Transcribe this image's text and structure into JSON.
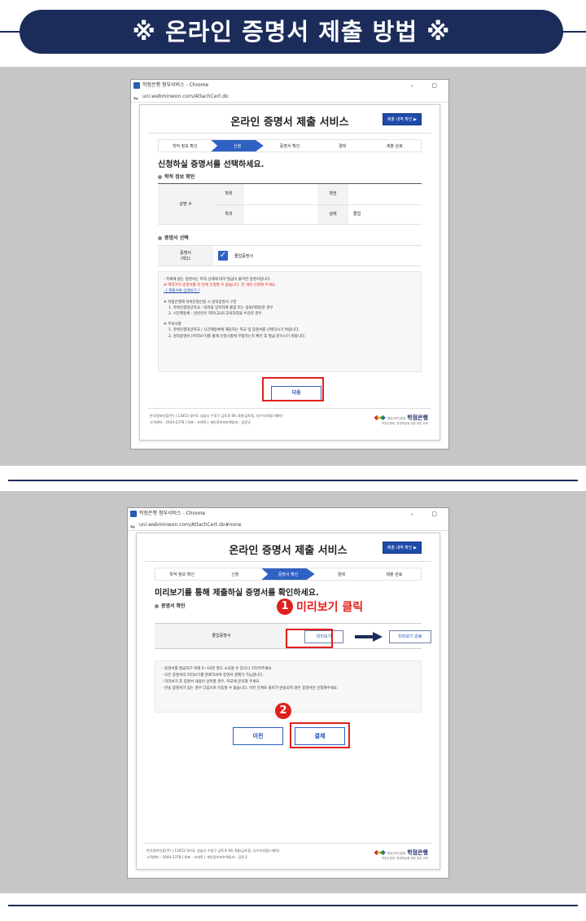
{
  "header": {
    "title": "※ 온라인 증명서 제출 방법 ※"
  },
  "window1": {
    "title": "학점은행 첨부서비스 - Chrome",
    "url": "uni.webminwon.com/AttachCert.do",
    "window_controls": "–  ▢",
    "service_title": "온라인 증명서 제출 서비스",
    "history_button": "제출 내역 확인 ▶",
    "steps": [
      "학적 정보 확인",
      "신청",
      "증명서 확인",
      "결제",
      "제출 완료"
    ],
    "active_step": "신청",
    "heading": "신청하실 증명서를 선택하세요.",
    "section_info": "학적 정보 확인",
    "info_row_header": "성명 수",
    "info_labels": [
      "학위",
      "학번",
      "학과",
      "상태"
    ],
    "info_status_value": "졸업",
    "section_cert": "증명서 선택",
    "cert_label_line1": "증명서",
    "cert_label_line2": "(택1)",
    "cert_name": "졸업증명서",
    "notice_lines": [
      "- 목록에 없는 증명서는 학적 상태에 따라 발급이 불가한 증명서입니다.",
      "※ 여러가지 증명서를 한 번에 신청할 수 없습니다. 한 개씩 신청해 주세요.",
      "- [ 제출서류 상세보기 ]",
      "※ 학점은행제 학위인정신청 시 성적증명서 구분",
      "1. 학위인정대상학교 : 대학을 입학하여 졸업 또는 중퇴(제적)한 경우",
      "2. 시간제등록 : 일반인이 대학(교)의 교육과정을 수강한 경우",
      "※ 주의사항",
      "1. 학위인정대상학교 / 시간제등록에 해당하는 학교 및 증명서를 선택하시기 바랍니다.",
      "2. 성적증명서 [미리보기]를 통해 신청사항에 부합하는지 확인 후 발급 받으시기 바랍니다."
    ],
    "next_button": "다음",
    "footer_line1": "한국정보인증(주) | 13453 경기도 성남시 수정구 금토로 69, 6층(금토동, 다우디지털스퀘어)",
    "footer_line2": "고객센터 : 1644-2378 | 대표 : 조태묵 | 개인정보보호책임자 : 김윤규",
    "logo_gov": "평생교육진흥원",
    "logo_name": "학점은행",
    "logo_sub": "학점은행제, 평생학습을 위한 열린 교육"
  },
  "window2": {
    "title": "학점은행 첨부서비스 - Chrome",
    "url": "uni.webminwon.com/AttachCert.do#none",
    "window_controls": "–  ▢",
    "service_title": "온라인 증명서 제출 서비스",
    "history_button": "제출 내역 확인 ▶",
    "steps": [
      "학적 정보 확인",
      "신청",
      "증명서 확인",
      "결제",
      "제출 완료"
    ],
    "active_step": "증명서 확인",
    "heading": "미리보기를 통해 제출하실 증명서를 확인하세요.",
    "section_confirm": "증명서 확인",
    "cert_name": "졸업증명서",
    "preview_button": "미리보기",
    "preview_done_button": "미리보기 완료",
    "notice_lines": [
      "- 증명서를 발급하기 위해 5~10분 정도 소요될 수 있으니 기다려주세요.",
      "- 모든 증명서의 미리보기를 완료하셔야 증명서 결제가 가능합니다.",
      "- 미리보기 후 증명서 내용이 상이할 경우, 학교에 문의해 주세요.",
      "- 반송 증명서가 있는 경우 다음으로 이동할 수 없습니다. 이전 단계로 돌아가 반송되지 않은 증명서만 신청해주세요."
    ],
    "prev_button": "이전",
    "pay_button": "결제",
    "footer_line1": "한국정보인증(주) | 13453 경기도 성남시 수정구 금토로 69, 6층(금토동, 다우디지털스퀘어)",
    "footer_line2": "고객센터 : 1644-2378 | 대표 : 조태묵 | 개인정보보호책임자 : 김윤규",
    "logo_gov": "평생교육진흥원",
    "logo_name": "학점은행",
    "logo_sub": "학점은행제, 평생학습을 위한 열린 교육"
  },
  "annotations": {
    "marker1": "1",
    "marker1_text": "미리보기 클릭",
    "marker2": "2"
  },
  "colors": {
    "navy": "#1c2c5a",
    "accent_blue": "#2f61c4",
    "highlight_red": "#e0211b",
    "panel_gray": "#c6c6c6"
  }
}
